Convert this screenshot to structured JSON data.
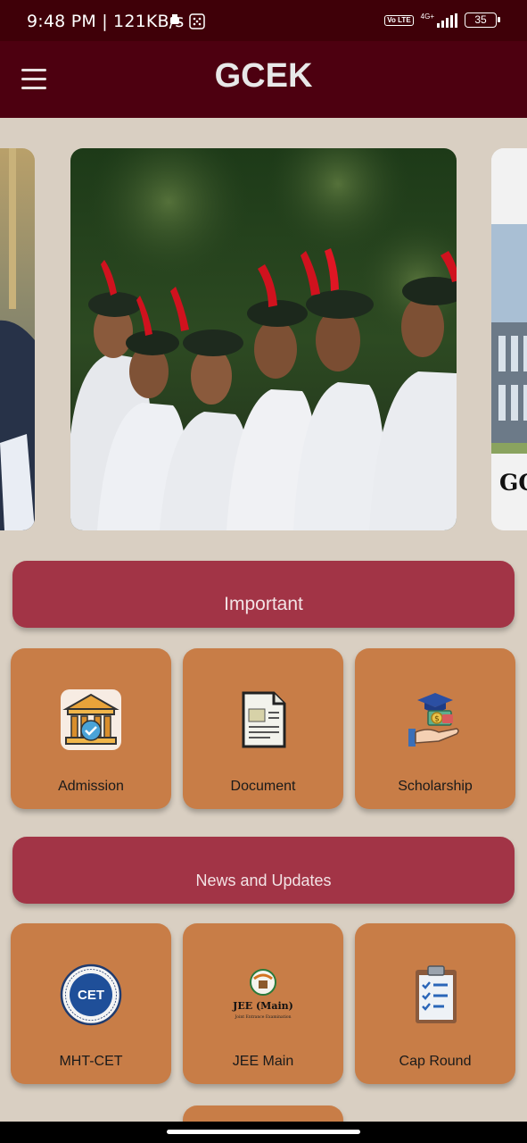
{
  "status_bar": {
    "time_network": "9:48 PM | 121KB/s",
    "volte": "Vo LTE",
    "network_type": "4G+",
    "battery": "35"
  },
  "app_bar": {
    "title": "GCEK",
    "menu_icon": "hamburger-menu-icon"
  },
  "carousel": {
    "partial_right_text": "GO"
  },
  "sections": [
    {
      "title": "Important",
      "tiles": [
        {
          "label": "Admission",
          "icon": "institution-badge-icon"
        },
        {
          "label": "Document",
          "icon": "document-icon"
        },
        {
          "label": "Scholarship",
          "icon": "scholarship-hand-icon"
        }
      ]
    },
    {
      "title": "News and Updates",
      "tiles": [
        {
          "label": "MHT-CET",
          "icon": "cet-logo-icon",
          "logo_text": "CET"
        },
        {
          "label": "JEE Main",
          "icon": "jee-main-logo-icon",
          "logo_text": "JEE (Main)",
          "logo_subtext": "Joint Entrance Examination"
        },
        {
          "label": "Cap Round",
          "icon": "clipboard-checklist-icon"
        }
      ]
    }
  ],
  "colors": {
    "status_bar": "#3f0008",
    "app_bar": "#4d0010",
    "background": "#d9cfc2",
    "section_header": "#a23446",
    "tile": "#c87d47"
  }
}
